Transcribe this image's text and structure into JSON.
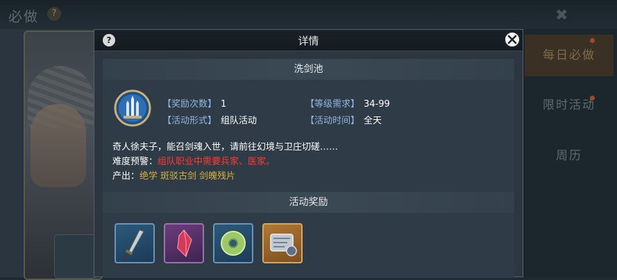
{
  "background": {
    "title": "必做",
    "help_glyph": "?",
    "close_glyph": "✖",
    "tabs": [
      "每日必做",
      "限时活动",
      "周历"
    ]
  },
  "dialog": {
    "title": "详情",
    "help_glyph": "?",
    "activity_name": "洗剑池",
    "fields": {
      "reward_count_label": "【奖励次数】",
      "reward_count_value": "1",
      "level_req_label": "【等级需求】",
      "level_req_value": "34-99",
      "form_label": "【活动形式】",
      "form_value": "组队活动",
      "time_label": "【活动时间】",
      "time_value": "全天"
    },
    "description": "奇人徐夫子，能召剑魂入世，请前往幻境与卫庄切磋……",
    "warning_label": "难度预警：",
    "warning_value": "组队职业中需要兵家、医家。",
    "output_label": "产出：",
    "output_items": [
      "绝学",
      "斑驳古剑",
      "剑魄残片"
    ],
    "rewards_title": "活动奖励",
    "reward_items": [
      {
        "icon": "dagger-icon",
        "rarity": "blue"
      },
      {
        "icon": "red-crystal-icon",
        "rarity": "purple"
      },
      {
        "icon": "jade-disc-icon",
        "rarity": "blue"
      },
      {
        "icon": "scroll-map-icon",
        "rarity": "gold"
      }
    ]
  },
  "colors": {
    "label_blue": "#8fb6e0",
    "warning_red": "#ff3b30",
    "output_gold": "#d5b23d"
  }
}
